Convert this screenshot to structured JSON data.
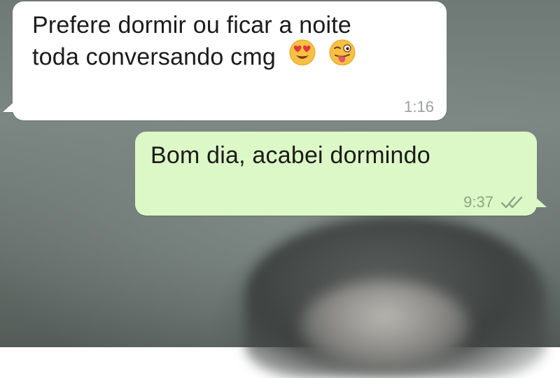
{
  "messages": [
    {
      "direction": "incoming",
      "line1": "Prefere dormir ou ficar a noite",
      "line2": "toda conversando cmg",
      "emojis": [
        "heart-eyes-emoji",
        "winking-tongue-emoji"
      ],
      "time": "1:16"
    },
    {
      "direction": "outgoing",
      "text": "Bom dia, acabei dormindo",
      "time": "9:37",
      "status": "double-tick-icon"
    }
  ],
  "colors": {
    "incoming_bubble": "#ffffff",
    "outgoing_bubble": "#dcf8c6",
    "text": "#1b1b1b",
    "timestamp": "#9aa19e"
  }
}
